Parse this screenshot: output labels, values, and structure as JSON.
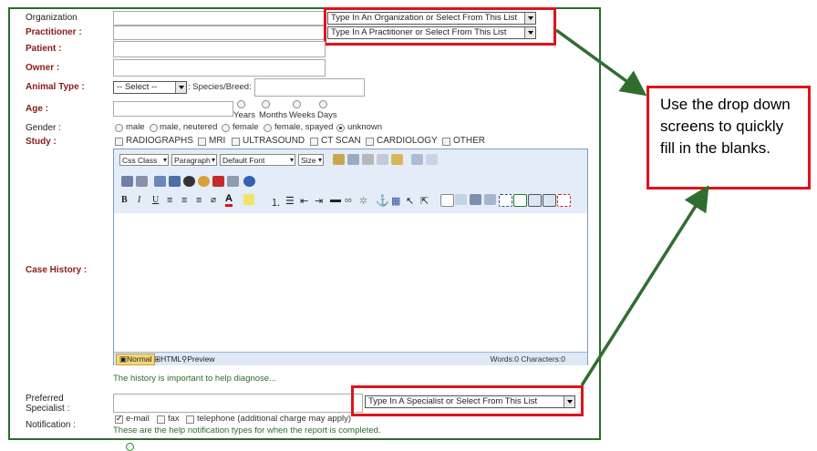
{
  "form": {
    "organization_label": "Organization",
    "practitioner_label": "Practitioner :",
    "patient_label": "Patient :",
    "owner_label": "Owner :",
    "animal_type_label": "Animal Type :",
    "age_label": "Age :",
    "gender_label": "Gender :",
    "study_label": "Study :",
    "case_history_label": "Case History :",
    "preferred_specialist_label_1": "Preferred",
    "preferred_specialist_label_2": "Specialist :",
    "notification_label": "Notification :",
    "organization_select": "Type In An Organization or Select From This List",
    "practitioner_select": "Type In A Practitioner or Select From This List",
    "specialist_select": "Type In A Specialist or Select From This List",
    "animal_type_select": "-- Select --",
    "species_breed_label": ": Species/Breed:",
    "age_units": [
      "Years",
      "Months",
      "Weeks",
      "Days"
    ],
    "gender_options": [
      "male",
      "male, neutered",
      "female",
      "female, spayed",
      "unknown"
    ],
    "gender_selected": "unknown",
    "study_options": [
      "RADIOGRAPHS",
      "MRI",
      "ULTRASOUND",
      "CT SCAN",
      "CARDIOLOGY",
      "OTHER"
    ],
    "history_hint": "The history is important to help diagnose...",
    "notification_options": [
      "e-mail",
      "fax",
      "telephone (additional charge may apply)"
    ],
    "notification_hint": "These are the help notification types for when the report is completed."
  },
  "editor": {
    "css_class": "Css Class",
    "paragraph": "Paragraph",
    "font": "Default Font",
    "size": "Size",
    "mode_normal": "Normal",
    "mode_html": "HTML",
    "mode_preview": "Preview",
    "stats": "Words:0 Characters:0",
    "toolbar_icons": [
      "cut-icon",
      "copy-icon",
      "paste-icon",
      "undo-icon",
      "redo-icon",
      "bold-icon",
      "italic-icon",
      "underline-icon",
      "align-left-icon",
      "align-center-icon",
      "align-right-icon",
      "font-color-icon",
      "highlight-icon",
      "ordered-list-icon",
      "unordered-list-icon",
      "outdent-icon",
      "indent-icon",
      "horizontal-rule-icon",
      "link-icon",
      "unlink-icon",
      "anchor-icon",
      "table-icon",
      "image-icon",
      "find-icon"
    ]
  },
  "callout": {
    "text": "Use the drop down screens to quickly fill in the blanks."
  },
  "colors": {
    "frame": "#2e6b2e",
    "label_red": "#8a1a1a",
    "highlight_red": "#e0121a",
    "arrow_green": "#2f6e2f"
  }
}
